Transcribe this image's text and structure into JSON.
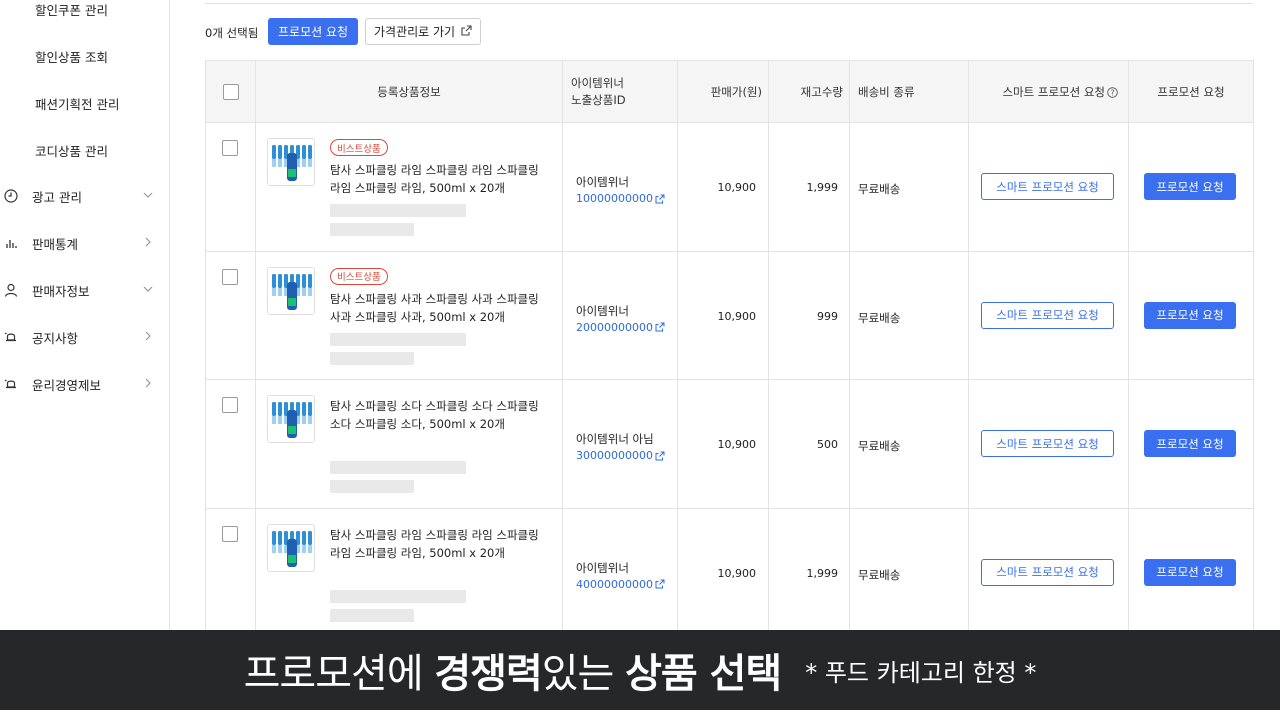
{
  "sidebar": {
    "sub_items": [
      {
        "label": "할인쿠폰 관리"
      },
      {
        "label": "할인상품 조회"
      },
      {
        "label": "패션기획전 관리"
      },
      {
        "label": "코디상품 관리"
      }
    ],
    "main_items": [
      {
        "label": "광고 관리",
        "icon": "clock-icon",
        "chevron": "chevron-down-icon"
      },
      {
        "label": "판매통계",
        "icon": "bar-chart-icon",
        "chevron": "chevron-right-icon"
      },
      {
        "label": "판매자정보",
        "icon": "person-icon",
        "chevron": "chevron-down-icon"
      },
      {
        "label": "공지사항",
        "icon": "bell-icon",
        "chevron": "chevron-right-icon"
      },
      {
        "label": "윤리경영제보",
        "icon": "bell-icon",
        "chevron": "chevron-right-icon"
      }
    ]
  },
  "toolbar": {
    "selected_count": "0개 선택됨",
    "promo_request_label": "프로모션 요청",
    "price_manage_label": "가격관리로 가기"
  },
  "table": {
    "headers": {
      "product_info": "등록상품정보",
      "item_winner_line1": "아이템위너",
      "item_winner_line2": "노출상품ID",
      "price": "판매가(원)",
      "stock": "재고수량",
      "shipping": "배송비 종류",
      "smart_promo": "스마트 프로모션 요청",
      "promo": "프로모션 요청"
    },
    "rows": [
      {
        "badge": "비스트상품",
        "name": "탐사 스파클링 라임 스파클링 라임 스파클링 라임 스파클링 라임, 500ml x 20개",
        "winner": "아이템위너",
        "id": "10000000000",
        "price": "10,900",
        "stock": "1,999",
        "shipping": "무료배송",
        "smart_label": "스마트 프로모션 요청",
        "promo_label": "프로모션 요청"
      },
      {
        "badge": "비스트상품",
        "name": "탐사 스파클링 사과 스파클링 사과 스파클링 사과 스파클링 사과, 500ml x 20개",
        "winner": "아이템위너",
        "id": "20000000000",
        "price": "10,900",
        "stock": "999",
        "shipping": "무료배송",
        "smart_label": "스마트 프로모션 요청",
        "promo_label": "프로모션 요청"
      },
      {
        "badge": "",
        "name": "탐사 스파클링 소다 스파클링 소다 스파클링 소다 스파클링 소다, 500ml x 20개",
        "winner": "아이템위너 아님",
        "id": "30000000000",
        "price": "10,900",
        "stock": "500",
        "shipping": "무료배송",
        "smart_label": "스마트 프로모션 요청",
        "promo_label": "프로모션 요청"
      },
      {
        "badge": "",
        "name": "탐사 스파클링 라임 스파클링 라임 스파클링 라임 스파클링 라임, 500ml x 20개",
        "winner": "아이템위너",
        "id": "40000000000",
        "price": "10,900",
        "stock": "1,999",
        "shipping": "무료배송",
        "smart_label": "스마트 프로모션 요청",
        "promo_label": "프로모션 요청"
      }
    ]
  },
  "caption": {
    "part1": "프로모션에 ",
    "part2": "경쟁력",
    "part3": "있는 ",
    "part4": "상품 선택",
    "note": "* 푸드 카테고리 한정 *"
  },
  "colors": {
    "accent": "#3a6ff0",
    "badge_red": "#d94a3a",
    "caption_bg": "#262729",
    "header_bg": "#f5f5f6"
  }
}
